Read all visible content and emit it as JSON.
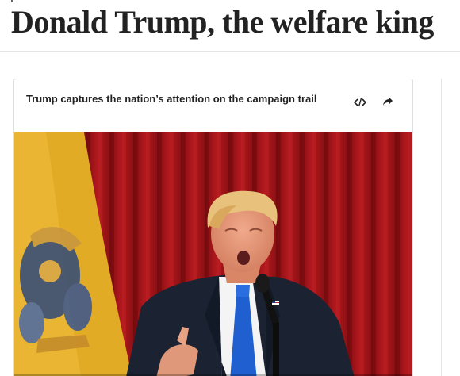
{
  "article": {
    "headline": "Donald Trump, the welfare king"
  },
  "video_card": {
    "title": "Trump captures the nation’s attention on the campaign trail",
    "embed_icon": "embed-code-icon",
    "share_icon": "share-arrow-icon",
    "thumbnail": "speaker-at-podium-photo"
  },
  "colors": {
    "headline": "#222222",
    "curtain": "#a3141a",
    "flag": "#e7b22e",
    "suit": "#1a2233",
    "tie": "#1f5fd0"
  }
}
